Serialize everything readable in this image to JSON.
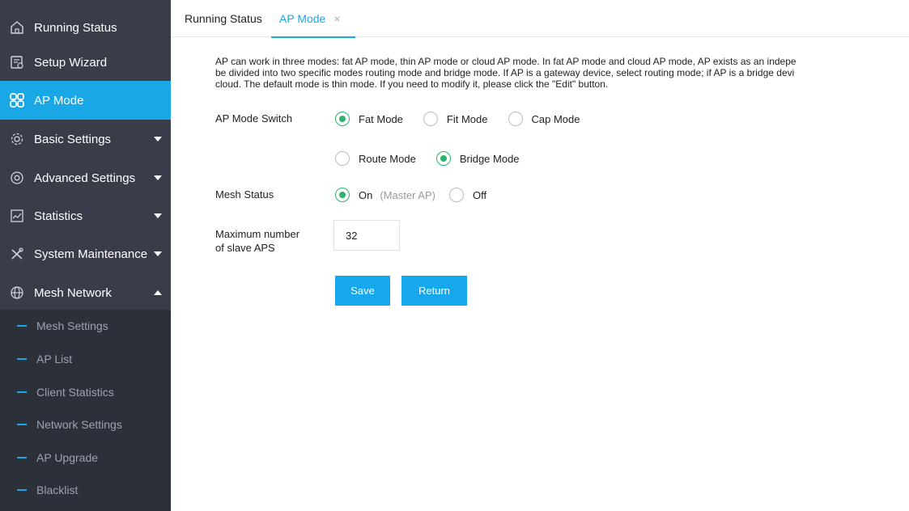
{
  "sidebar": {
    "items": [
      {
        "label": "Running Status",
        "icon": "home-icon"
      },
      {
        "label": "Setup Wizard",
        "icon": "wizard-icon"
      },
      {
        "label": "AP Mode",
        "icon": "grid-icon",
        "active": true
      },
      {
        "label": "Basic Settings",
        "icon": "gear-icon"
      },
      {
        "label": "Advanced Settings",
        "icon": "advanced-gear-icon"
      },
      {
        "label": "Statistics",
        "icon": "chart-icon"
      },
      {
        "label": "System Maintenance",
        "icon": "tools-icon"
      },
      {
        "label": "Mesh Network",
        "icon": "globe-icon",
        "expanded": true
      }
    ],
    "sub_items": [
      {
        "label": "Mesh Settings"
      },
      {
        "label": "AP List"
      },
      {
        "label": "Client Statistics"
      },
      {
        "label": "Network Settings"
      },
      {
        "label": "AP Upgrade"
      },
      {
        "label": "Blacklist"
      }
    ],
    "colors": {
      "background": "#383d49",
      "active": "#19a7e6",
      "submenu": "#2c3039"
    }
  },
  "tabs": [
    {
      "label": "Running Status"
    },
    {
      "label": "AP Mode",
      "active": true,
      "close": "×"
    }
  ],
  "description": {
    "line1": "AP can work in three modes: fat AP mode, thin AP mode or cloud AP mode. In fat AP mode and cloud AP mode, AP exists as an indepe",
    "line2": "be divided into two specific modes routing mode and bridge mode. If AP is a gateway device, select routing mode; if AP is a bridge devi",
    "line3": "cloud. The default mode is thin mode. If you need to modify it, please click the \"Edit\" button."
  },
  "form": {
    "ap_mode_switch": {
      "label": "AP Mode Switch",
      "options": [
        {
          "label": "Fat Mode",
          "checked": true
        },
        {
          "label": "Fit Mode",
          "checked": false
        },
        {
          "label": "Cap Mode",
          "checked": false
        }
      ]
    },
    "sub_mode": {
      "options": [
        {
          "label": "Route Mode",
          "checked": false
        },
        {
          "label": "Bridge Mode",
          "checked": true
        }
      ]
    },
    "mesh_status": {
      "label": "Mesh Status",
      "options": [
        {
          "label": "On",
          "checked": true,
          "hint": "(Master AP)"
        },
        {
          "label": "Off",
          "checked": false
        }
      ]
    },
    "max_slave": {
      "label_line1": "Maximum number",
      "label_line2": "of slave APS",
      "value": "32"
    },
    "buttons": {
      "save": "Save",
      "return": "Return"
    }
  },
  "colors": {
    "accent": "#19a7e6",
    "radio_checked": "#2fb36a",
    "button": "#16a8ec"
  }
}
